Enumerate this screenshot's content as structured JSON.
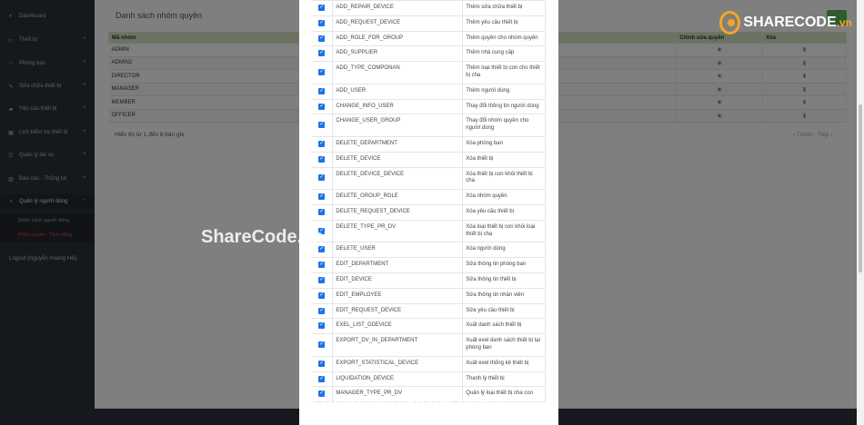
{
  "sidebar": {
    "items": [
      {
        "label": "Dashboard",
        "icon": "dashboard-icon"
      },
      {
        "label": "Thiết bị",
        "icon": "monitor-icon"
      },
      {
        "label": "Phòng ban",
        "icon": "home-icon"
      },
      {
        "label": "Sửa chữa thiết bị",
        "icon": "wrench-icon"
      },
      {
        "label": "Yêu cầu thiết bị",
        "icon": "truck-icon"
      },
      {
        "label": "Lịch kiểm tra thiết bị",
        "icon": "calendar-icon"
      },
      {
        "label": "Quản lý tác vụ",
        "icon": "tasks-icon"
      },
      {
        "label": "Báo cáo - Thống kê",
        "icon": "chart-icon"
      },
      {
        "label": "Quản lý người dùng",
        "icon": "user-icon"
      }
    ],
    "sub_items": [
      "Danh sách người dùng",
      "Phân quyền - Tính năng"
    ],
    "logout": "Logout (Nguyễn Hoàng Hải)"
  },
  "main": {
    "title": "Danh sách nhóm quyền",
    "columns": [
      "Mã nhóm",
      "Chỉnh sửa quyền",
      "Xóa"
    ],
    "rows": [
      "ADMIN",
      "ADMIN2",
      "DIRECTOR",
      "MANAGER",
      "MEMBER",
      "OFFICER"
    ],
    "summary": "Hiển thị từ 1 đến 6 bản ghi",
    "pager_prev": "Trước",
    "pager_next": "Tiếp"
  },
  "modal": {
    "permissions": [
      {
        "code": "ADD_REPAIR_DEVICE",
        "desc": "Thêm sửa chữa thiết bị"
      },
      {
        "code": "ADD_REQUEST_DEVICE",
        "desc": "Thêm yêu cầu thiết bị"
      },
      {
        "code": "ADD_ROLE_FOR_GROUP",
        "desc": "Thêm quyền cho nhóm quyền"
      },
      {
        "code": "ADD_SUPPLIER",
        "desc": "Thêm nhà cung cấp"
      },
      {
        "code": "ADD_TYPE_COMPONAN",
        "desc": "Thêm loại thiết bị con cho thiết bị cha"
      },
      {
        "code": "ADD_USER",
        "desc": "Thêm người dùng"
      },
      {
        "code": "CHANGE_INFO_USER",
        "desc": "Thay đổi thông tin người dùng"
      },
      {
        "code": "CHANGE_USER_GROUP",
        "desc": "Thay đổi nhóm quyền cho người dùng"
      },
      {
        "code": "DELETE_DEPARTMENT",
        "desc": "Xóa phòng ban"
      },
      {
        "code": "DELETE_DEVICE",
        "desc": "Xóa thiết bị"
      },
      {
        "code": "DELETE_DEVICE_DEVICE",
        "desc": "Xóa thiết bị con khỏi thiết bị cha"
      },
      {
        "code": "DELETE_GROUP_ROLE",
        "desc": "Xóa nhóm quyền"
      },
      {
        "code": "DELETE_REQUEST_DEVICE",
        "desc": "Xóa yêu cầu thiết bị"
      },
      {
        "code": "DELETE_TYPE_PR_DV",
        "desc": "Xóa loại thiết bị con khỏi loại thiết bị cha"
      },
      {
        "code": "DELETE_USER",
        "desc": "Xóa người dùng"
      },
      {
        "code": "EDIT_DEPARTMENT",
        "desc": "Sửa thông tin phòng ban"
      },
      {
        "code": "EDIT_DEVICE",
        "desc": "Sửa thông tin thiết bị"
      },
      {
        "code": "EDIT_EMPLOYEE",
        "desc": "Sửa thông tin nhân viên"
      },
      {
        "code": "EDIT_REQUEST_DEVICE",
        "desc": "Sửa yêu cầu thiết bị"
      },
      {
        "code": "EXEL_LIST_DDEVICE",
        "desc": "Xuất danh sách thiết bị"
      },
      {
        "code": "EXPORT_DV_IN_DEPARTMENT",
        "desc": "Xuất exel danh sách thiết bị tại phòng ban"
      },
      {
        "code": "EXPORT_STATISTICAL_DEVICE",
        "desc": "Xuất exel thống kê thiết bị"
      },
      {
        "code": "LIQUIDATION_DEVICE",
        "desc": "Thanh lý thiết bị"
      },
      {
        "code": "MANAGER_TYPE_PR_DV",
        "desc": "Quản lý loại thiết bị cha con"
      }
    ]
  },
  "watermarks": {
    "center": "ShareCode.vn",
    "bottom": "Copyright © ShareCode.vn",
    "logo_main": "SHARECODE",
    "logo_tld": ".vn"
  },
  "colors": {
    "sidebar_bg": "#2b3038",
    "table_header": "#d7e5c3",
    "checkbox": "#1a73e8",
    "active_accent": "#e74c3c",
    "logo_accent": "#f5a623"
  }
}
